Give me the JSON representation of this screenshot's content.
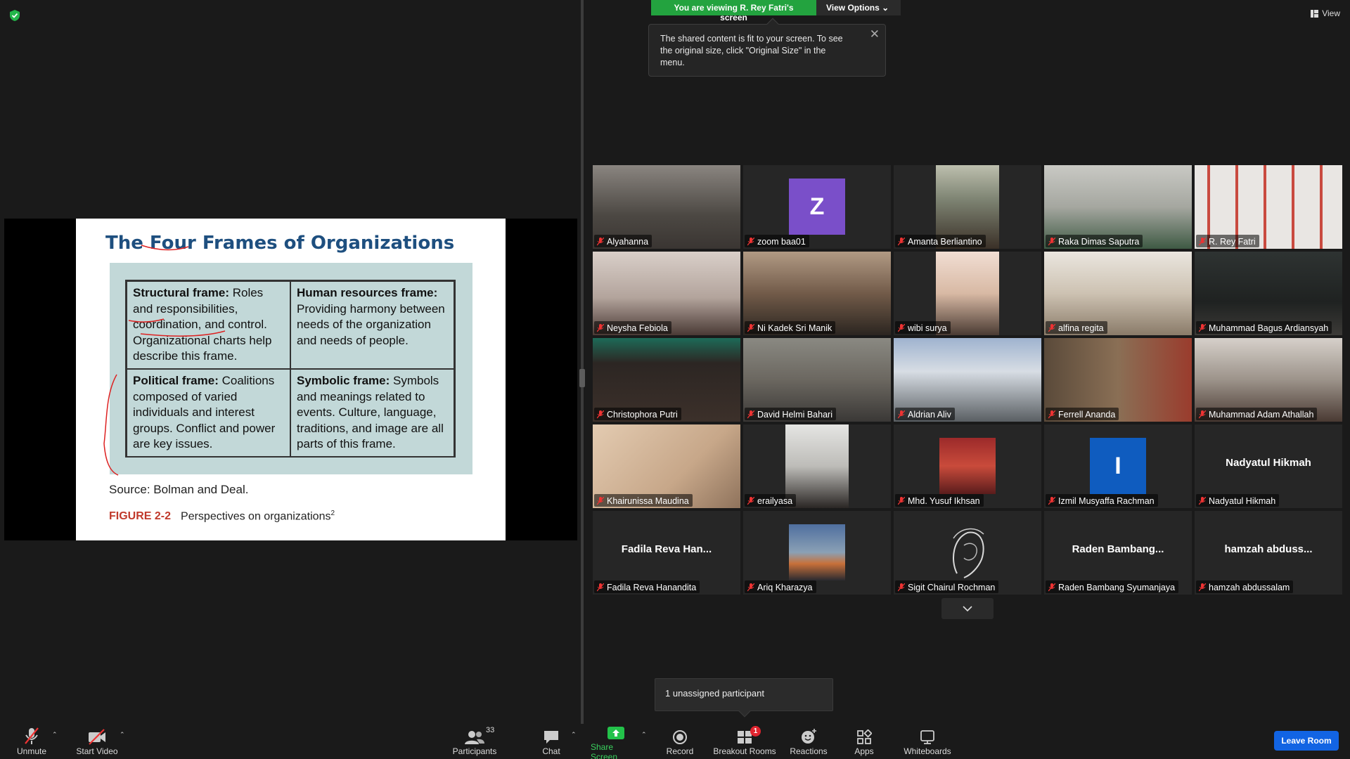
{
  "banner": {
    "viewing_text": "You are viewing R. Rey Fatri's screen",
    "view_options_label": "View Options"
  },
  "tooltip": {
    "text": "The shared content is fit to your screen. To see the original size, click \"Original Size\" in the menu."
  },
  "view_button": {
    "label": "View"
  },
  "slide": {
    "title": "The Four Frames of Organizations",
    "frames": [
      {
        "heading": "Structural frame:",
        "body": " Roles and responsibilities, coordination, and control. Organizational charts help describe this frame."
      },
      {
        "heading": "Human resources frame:",
        "body": " Providing harmony between needs of the organization and needs of people."
      },
      {
        "heading": "Political frame:",
        "body": " Coalitions composed of varied individuals and interest groups. Conflict and power are key issues."
      },
      {
        "heading": "Symbolic frame:",
        "body": " Symbols and meanings related to events. Culture, language, traditions, and image are all parts of this frame."
      }
    ],
    "source": "Source: Bolman and Deal.",
    "figure_number": "FIGURE 2-2",
    "figure_caption": "Perspectives on organizations",
    "figure_sup": "2"
  },
  "participants": [
    {
      "name": "Alyahanna"
    },
    {
      "name": "zoom baa01",
      "avatar_letter": "Z",
      "avatar_color": "#7a4fc9"
    },
    {
      "name": "Amanta Berliantino"
    },
    {
      "name": "Raka Dimas Saputra"
    },
    {
      "name": "R. Rey Fatri"
    },
    {
      "name": "Neysha Febiola"
    },
    {
      "name": "Ni Kadek Sri Manik"
    },
    {
      "name": "wibi surya"
    },
    {
      "name": "alfina regita"
    },
    {
      "name": "Muhammad Bagus Ardiansyah"
    },
    {
      "name": "Christophora Putri"
    },
    {
      "name": "David Helmi Bahari"
    },
    {
      "name": "Aldrian Aliv"
    },
    {
      "name": "Ferrell Ananda"
    },
    {
      "name": "Muhammad Adam Athallah"
    },
    {
      "name": "Khairunissa Maudina"
    },
    {
      "name": "erailyasa"
    },
    {
      "name": "Mhd. Yusuf Ikhsan"
    },
    {
      "name": "Izmil Musyaffa Rachman",
      "avatar_letter": "I",
      "avatar_color": "#0f5cbf"
    },
    {
      "name": "Nadyatul Hikmah",
      "display_name": "Nadyatul Hikmah"
    },
    {
      "name": "Fadila Reva Hanandita",
      "display_name": "Fadila Reva Han..."
    },
    {
      "name": "Ariq Kharazya"
    },
    {
      "name": "Sigit Chairul Rochman"
    },
    {
      "name": "Raden Bambang Syumanjaya",
      "display_name": "Raden  Bambang..."
    },
    {
      "name": "hamzah abdussalam",
      "display_name": "hamzah abduss..."
    }
  ],
  "unassigned": {
    "text": "1 unassigned participant"
  },
  "toolbar": {
    "unmute": "Unmute",
    "start_video": "Start Video",
    "participants": "Participants",
    "participants_count": "33",
    "chat": "Chat",
    "share_screen": "Share Screen",
    "record": "Record",
    "breakout_rooms": "Breakout Rooms",
    "breakout_badge": "1",
    "reactions": "Reactions",
    "apps": "Apps",
    "whiteboards": "Whiteboards",
    "leave_room": "Leave Room"
  },
  "colors": {
    "accent_green": "#23a33f",
    "leave_blue": "#1264e3",
    "active_speaker": "#ffe94d"
  }
}
